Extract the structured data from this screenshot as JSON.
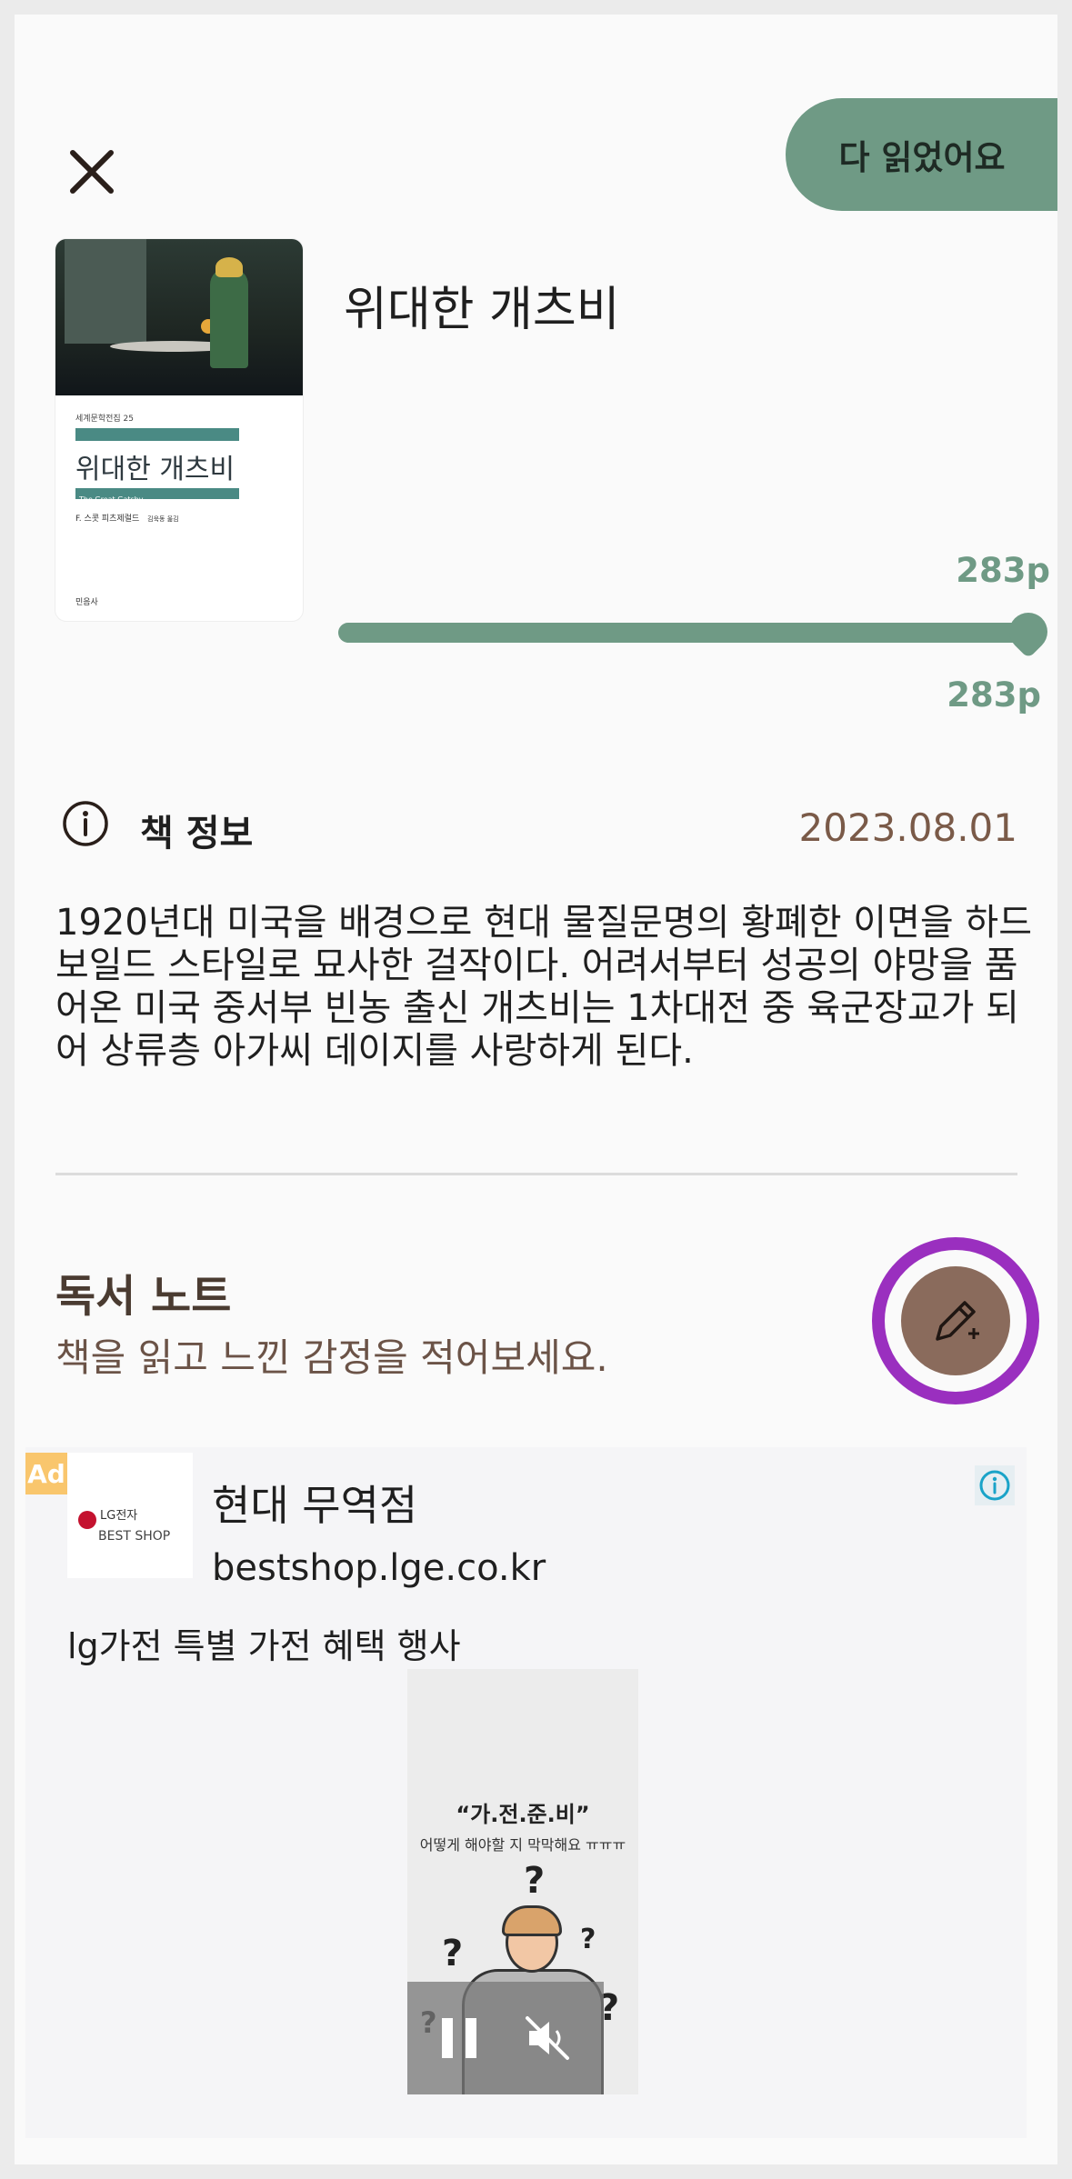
{
  "header": {
    "close_icon": "close-icon",
    "finish_label": "다 읽었어요"
  },
  "book": {
    "title": "위대한 개츠비",
    "cover": {
      "series": "세계문학전집 25",
      "title": "위대한 개츠비",
      "subtitle": "The Great Gatsby",
      "author": "F. 스콧 피츠제럴드",
      "translator": "김욱동 옮김",
      "publisher": "민음사"
    },
    "progress": {
      "current_label": "283p",
      "total_label": "283p",
      "fraction": 1.0
    }
  },
  "info": {
    "label": "책 정보",
    "date": "2023.08.01",
    "description": "1920년대 미국을 배경으로 현대 물질문명의 황폐한 이면을 하드보일드 스타일로 묘사한 걸작이다. 어려서부터 성공의 야망을 품어온 미국 중서부 빈농 출신 개츠비는 1차대전 중 육군장교가 되어 상류층 아가씨 데이지를 사랑하게 된다."
  },
  "notes": {
    "title": "독서 노트",
    "subtitle": "책을 읽고 느낀 감정을 적어보세요.",
    "fab_icon": "pencil-plus-icon"
  },
  "ad": {
    "badge": "Ad",
    "logo_brand": "LG전자",
    "logo_shop": "BEST SHOP",
    "title": "현대 무역점",
    "url": "bestshop.lge.co.kr",
    "body": "lg가전 특별 가전 혜택 행사",
    "image_title": "“가.전.준.비”",
    "image_sub": "어떻게 해야할 지 막막해요 ㅠㅠㅠ",
    "image_marks": [
      "?",
      "?",
      "?",
      "?",
      "?"
    ]
  },
  "colors": {
    "accent_green": "#6f9a85",
    "date_brown": "#7a5a48",
    "fab_brown": "#8a6b5c",
    "fab_ring": "#9a2fbf",
    "ad_badge": "#f9c66d"
  }
}
